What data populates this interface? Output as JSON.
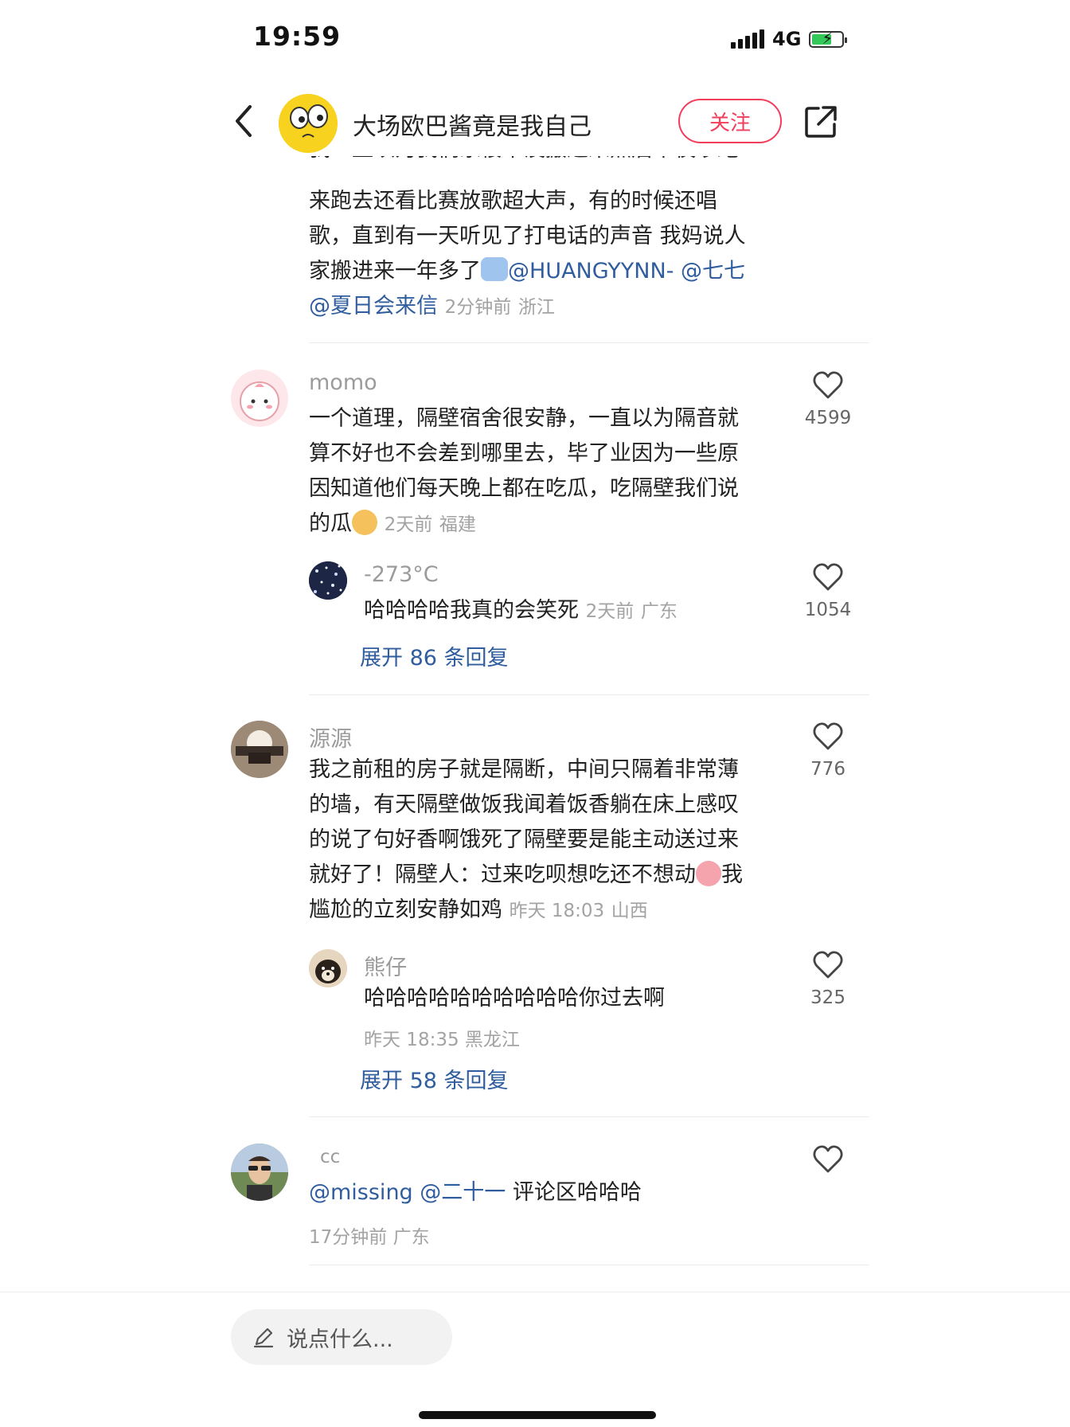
{
  "status": {
    "time": "19:59",
    "network": "4G"
  },
  "header": {
    "title": "大场欧巴酱竟是我自己",
    "follow_label": "关注"
  },
  "prev_comment": {
    "line0": "我一直以为我们家楼下没搬进来点后半夜吵跑",
    "line1": "来跑去还看比赛放歌超大声，有的时候还唱",
    "line2": "歌，直到有一天听见了打电话的声音 我妈说人",
    "line3": "家搬进来一年多了",
    "mention1": "@HUANGYYNN-",
    "mention2": "@七七",
    "mention3": "@夏日会来信",
    "time": "2分钟前",
    "region": "浙江"
  },
  "comments": [
    {
      "user": "momo",
      "lines": [
        "一个道理，隔壁宿舍很安静，一直以为隔音就",
        "算不好也不会差到哪里去，毕了业因为一些原",
        "因知道他们每天晚上都在吃瓜，吃隔壁我们说",
        "的瓜"
      ],
      "time": "2天前",
      "region": "福建",
      "likes": "4599",
      "reply": {
        "user": "-273°C",
        "text": "哈哈哈哈我真的会笑死",
        "time": "2天前",
        "region": "广东",
        "likes": "1054"
      },
      "expand": "展开 86 条回复"
    },
    {
      "user": "源源",
      "lines": [
        "我之前租的房子就是隔断，中间只隔着非常薄",
        "的墙，有天隔壁做饭我闻着饭香躺在床上感叹",
        "的说了句好香啊饿死了隔壁要是能主动送过来",
        "就好了！隔壁人：过来吃呗想吃还不想动",
        "我",
        "尴尬的立刻安静如鸡"
      ],
      "time": "昨天 18:03",
      "region": "山西",
      "likes": "776",
      "reply": {
        "user": "熊仔",
        "text": "哈哈哈哈哈哈哈哈哈哈你过去啊",
        "time": "昨天 18:35",
        "region": "黑龙江",
        "likes": "325"
      },
      "expand": "展开 58 条回复"
    },
    {
      "user": "cc",
      "mention1": "@missing",
      "mention2": "@二十一",
      "text": "评论区哈哈哈",
      "time": "17分钟前",
      "region": "广东"
    }
  ],
  "input": {
    "placeholder": "说点什么..."
  },
  "colors": {
    "accent": "#f23d5c",
    "link": "#2f5d9e",
    "meta": "#a3a3a3"
  },
  "icons": {
    "back": "chevron-left-icon",
    "share": "share-icon",
    "like": "heart-outline-icon",
    "edit": "pencil-icon"
  }
}
